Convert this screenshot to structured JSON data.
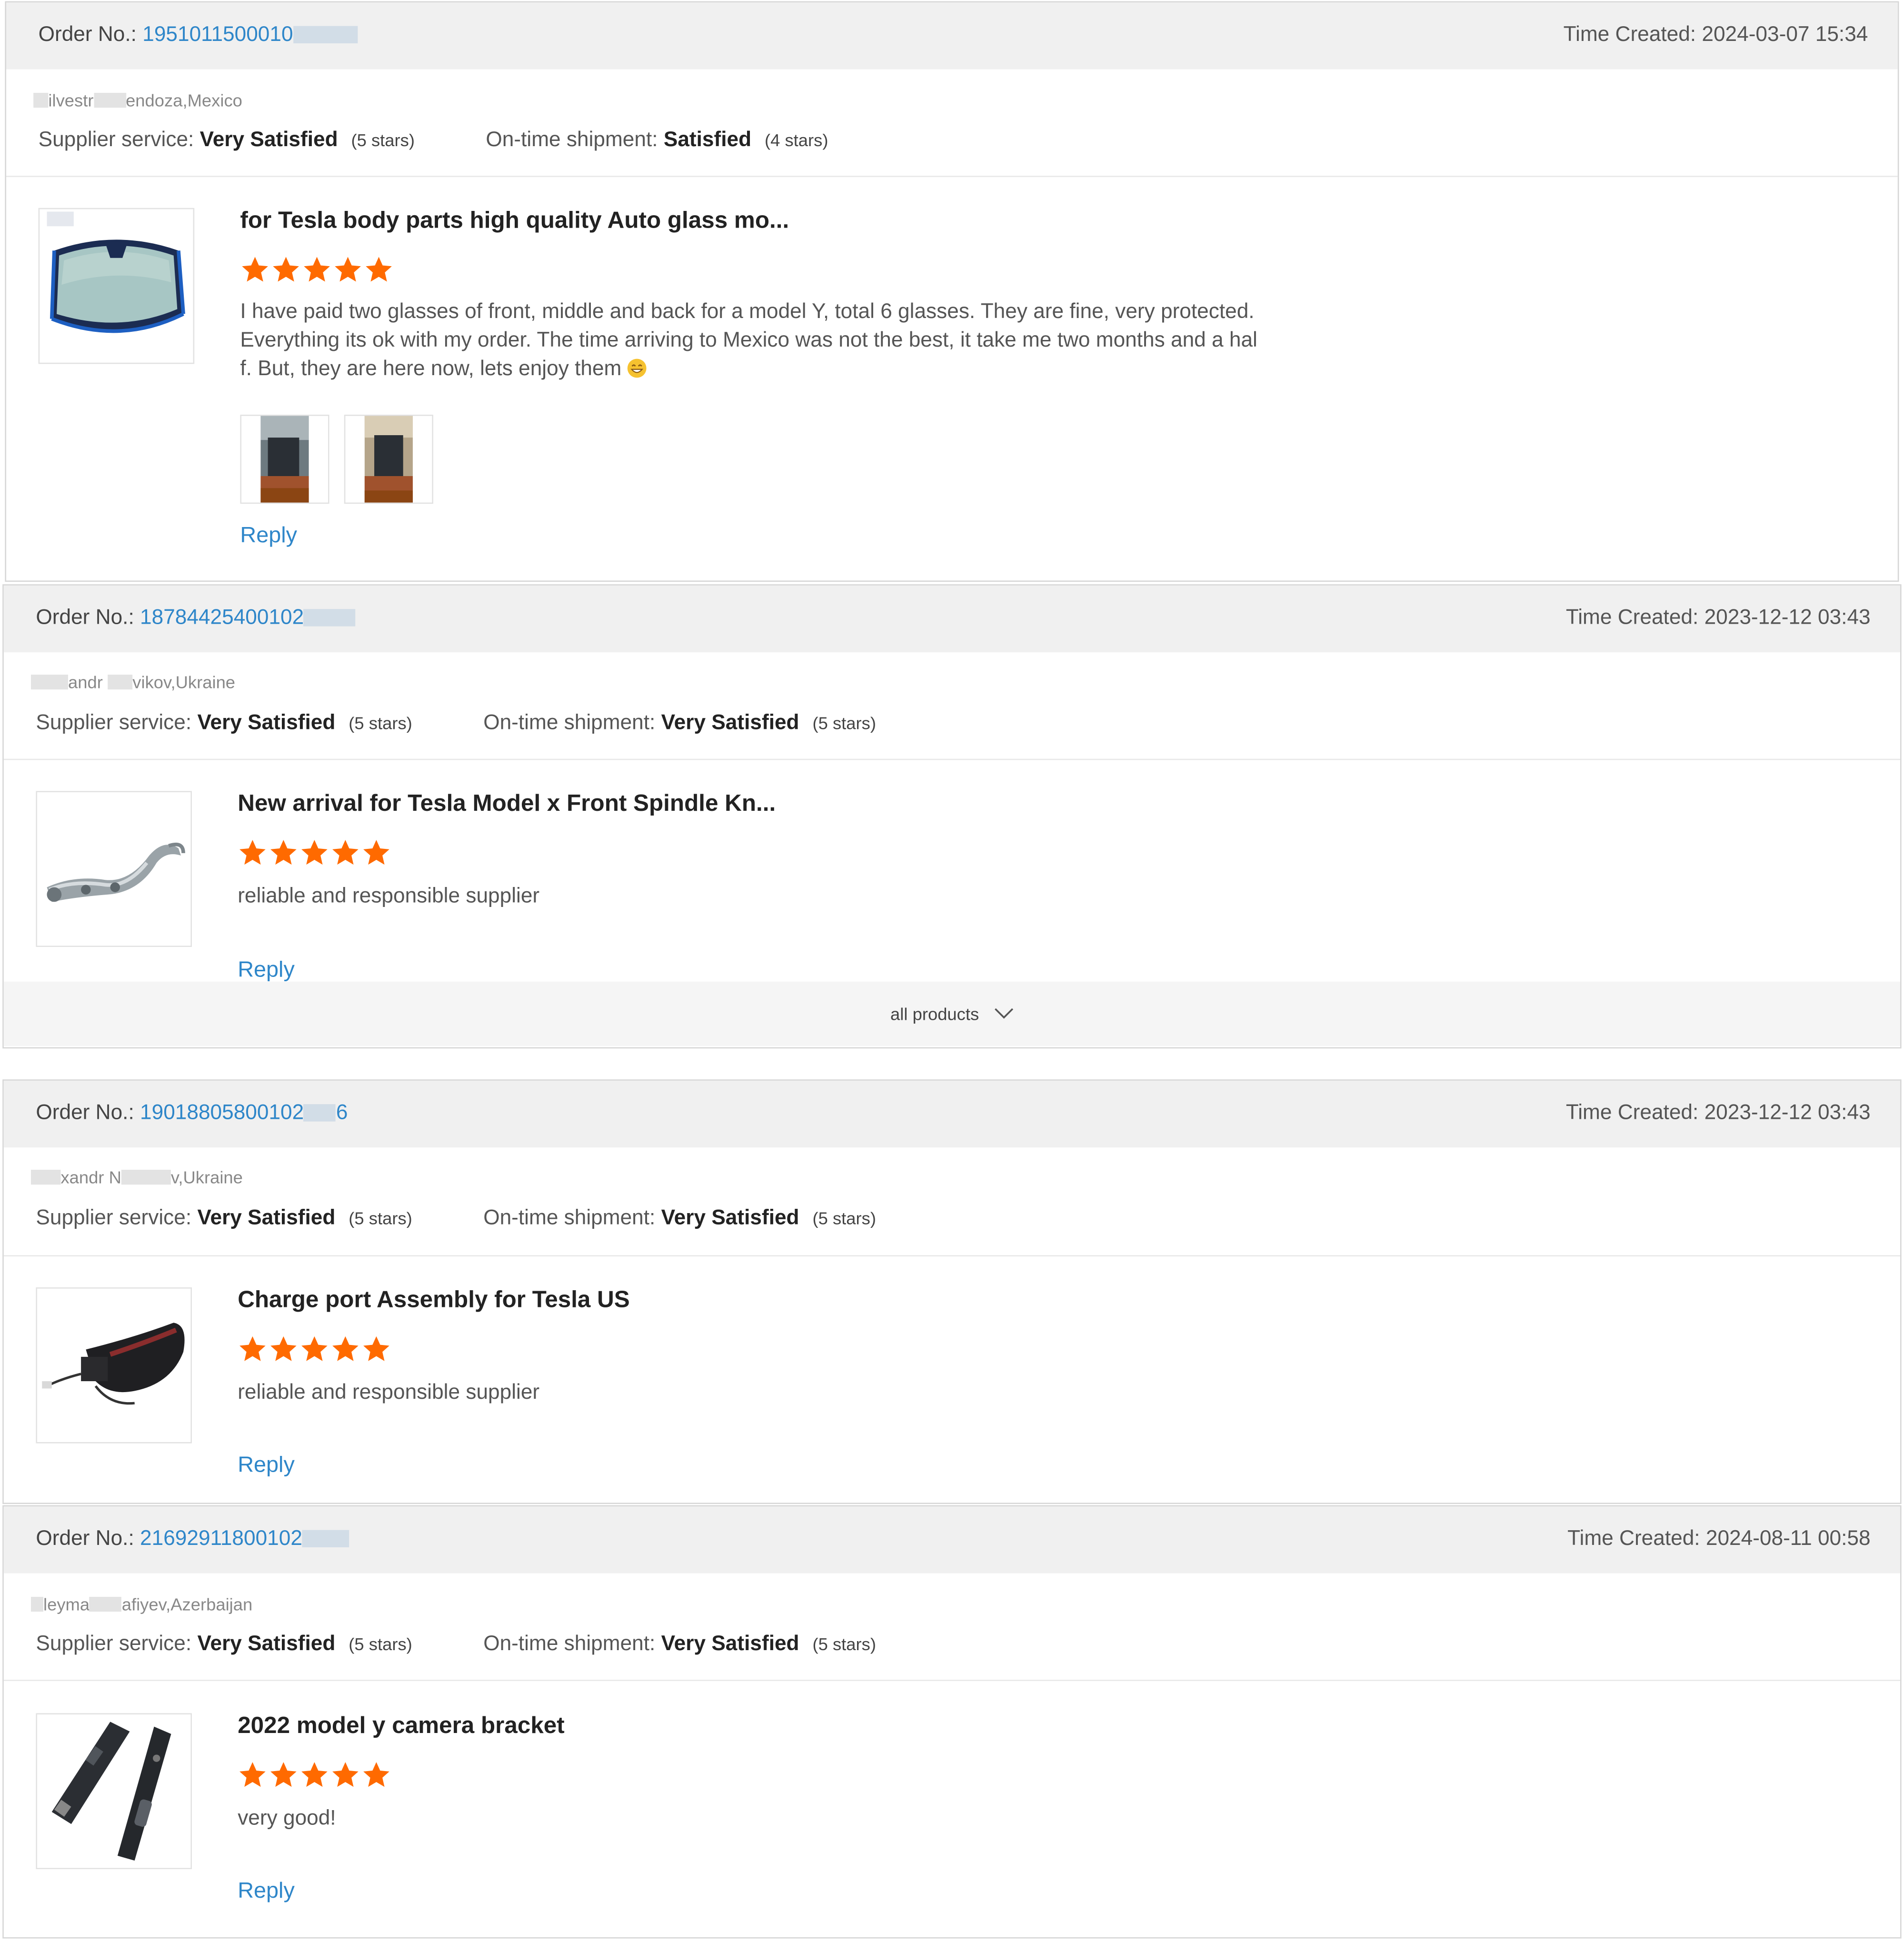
{
  "labels": {
    "order_no": "Order No.:",
    "time_created": "Time Created:",
    "supplier_service": "Supplier service:",
    "ontime_shipment": "On-time shipment:",
    "reply": "Reply",
    "all_products": "all products"
  },
  "colors": {
    "link": "#2e86c9",
    "star": "#ff6a00",
    "header_bg": "#f0f0f0"
  },
  "reviews": [
    {
      "order_no_visible": "1951011500010",
      "time": "2024-03-07 15:34",
      "buyer_parts": [
        "ilvestr",
        "endoza,Mexico"
      ],
      "supplier_service": "Very Satisfied",
      "supplier_stars": "(5 stars)",
      "shipment": "Satisfied",
      "shipment_stars": "(4 stars)",
      "product_title": "for Tesla body parts high quality Auto glass mo...",
      "product_icon": "windshield-image",
      "rating": 5,
      "comment": "I have paid two glasses of front, middle and back for a model Y, total 6 glasses. They are fine, very protected. Everything its ok with my order. The time arriving to Mexico was not the best, it take me two months and a half. But, they are here now, lets enjoy them",
      "photos": 2
    },
    {
      "order_no_visible": "18784425400102",
      "time": "2023-12-12 03:43",
      "buyer_parts": [
        "andr",
        "vikov,Ukraine"
      ],
      "supplier_service": "Very Satisfied",
      "supplier_stars": "(5 stars)",
      "shipment": "Very Satisfied",
      "shipment_stars": "(5 stars)",
      "product_title": "New arrival for Tesla Model x Front Spindle Kn...",
      "product_icon": "spindle-knuckle-image",
      "rating": 5,
      "comment": "reliable and responsible supplier"
    },
    {
      "order_no_visible": "19018805800102",
      "order_no_suffix": "6",
      "time": "2023-12-12 03:43",
      "buyer_parts": [
        "xandr N",
        "v,Ukraine"
      ],
      "supplier_service": "Very Satisfied",
      "supplier_stars": "(5 stars)",
      "shipment": "Very Satisfied",
      "shipment_stars": "(5 stars)",
      "product_title": "Charge port Assembly for Tesla US",
      "product_icon": "charge-port-image",
      "rating": 5,
      "comment": "reliable and responsible supplier"
    },
    {
      "order_no_visible": "21692911800102",
      "time": "2024-08-11 00:58",
      "buyer_parts": [
        "leyma",
        "afiyev,Azerbaijan"
      ],
      "supplier_service": "Very Satisfied",
      "supplier_stars": "(5 stars)",
      "shipment": "Very Satisfied",
      "shipment_stars": "(5 stars)",
      "product_title": "2022 model y camera bracket",
      "product_icon": "camera-bracket-image",
      "rating": 5,
      "comment": "very good!"
    }
  ]
}
